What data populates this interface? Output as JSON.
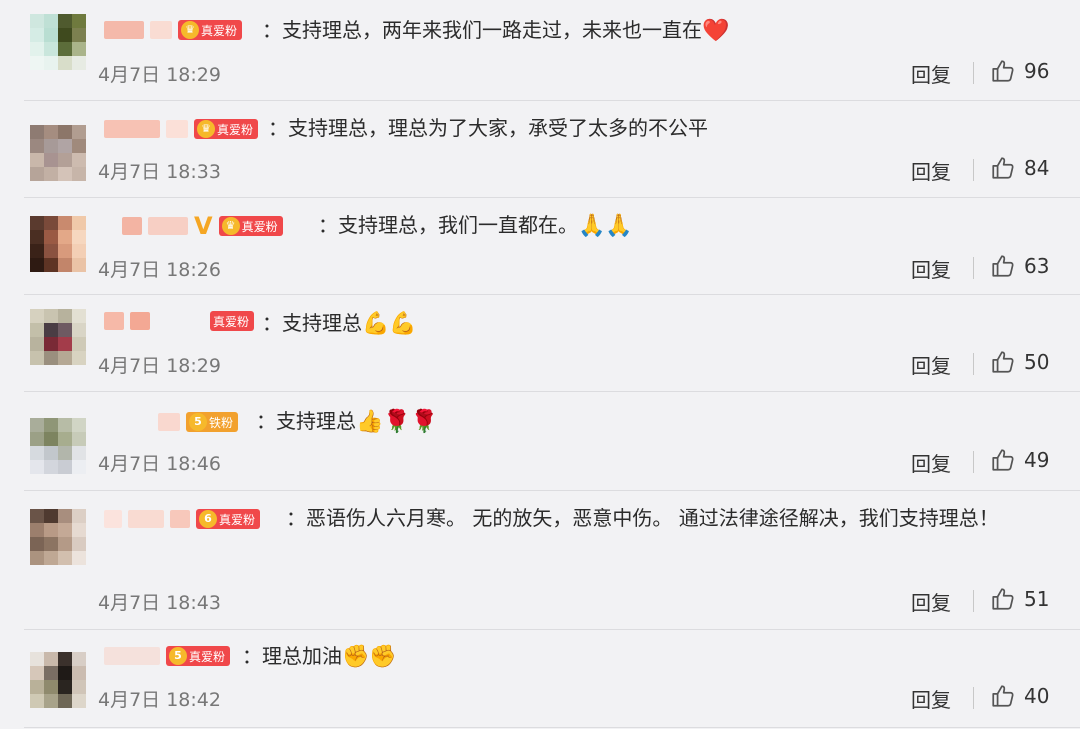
{
  "comments": [
    {
      "badge": "真爱粉",
      "badge_level": "",
      "badge_color": "#f0484a",
      "verified": false,
      "text": "：支持理总，两年来我们一路走过，未来也一直在",
      "emoji": "❤️",
      "date": "4月7日 18:29",
      "reply": "回复",
      "likes": "96"
    },
    {
      "badge": "真爱粉",
      "badge_level": "",
      "badge_color": "#f0484a",
      "verified": false,
      "text": "：支持理总，理总为了大家，承受了太多的不公平",
      "emoji": "",
      "date": "4月7日 18:33",
      "reply": "回复",
      "likes": "84"
    },
    {
      "badge": "真爱粉",
      "badge_level": "",
      "badge_color": "#f0484a",
      "verified": true,
      "verified_mark": "V",
      "text": "：支持理总，我们一直都在。",
      "emoji": "🙏🙏",
      "date": "4月7日 18:26",
      "reply": "回复",
      "likes": "63"
    },
    {
      "badge": "真爱粉",
      "badge_level": "",
      "badge_color": "#f0484a",
      "verified": false,
      "text": "：支持理总",
      "emoji": "💪💪",
      "date": "4月7日 18:29",
      "reply": "回复",
      "likes": "50"
    },
    {
      "badge": "铁粉",
      "badge_level": "5",
      "badge_color": "#f2a12e",
      "verified": false,
      "text": "：支持理总",
      "emoji": "👍🌹🌹",
      "date": "4月7日 18:46",
      "reply": "回复",
      "likes": "49"
    },
    {
      "badge": "真爱粉",
      "badge_level": "6",
      "badge_color": "#f0484a",
      "verified": false,
      "text": "：恶语伤人六月寒。 无的放矢，恶意中伤。 通过法律途径解决，我们支持理总！",
      "emoji": "",
      "date": "4月7日 18:43",
      "reply": "回复",
      "likes": "51"
    },
    {
      "badge": "真爱粉",
      "badge_level": "5",
      "badge_color": "#f0484a",
      "verified": false,
      "text": "：理总加油",
      "emoji": "✊✊",
      "date": "4月7日 18:42",
      "reply": "回复",
      "likes": "40"
    }
  ],
  "icons": {
    "like": "thumbs-up-icon",
    "badge": "crown-icon"
  }
}
